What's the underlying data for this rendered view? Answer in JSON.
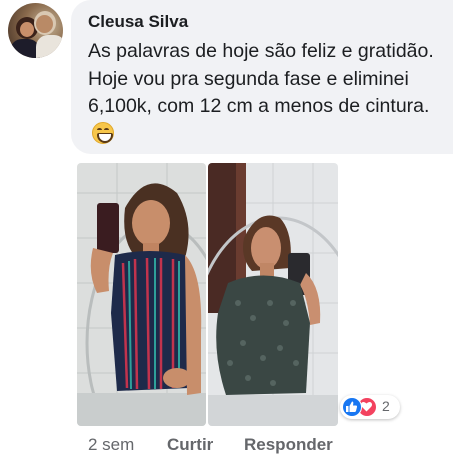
{
  "comment": {
    "author": "Cleusa Silva",
    "text": "As palavras de hoje são feliz e gratidão. Hoje vou pra segunda fase e eliminei 6,100k, com 12 cm a menos de cintura.",
    "emoji": "grinning-face-with-smiling-eyes"
  },
  "reactions": {
    "types": [
      "like",
      "love"
    ],
    "count": "2"
  },
  "actions": {
    "time": "2 sem",
    "like_label": "Curtir",
    "reply_label": "Responder"
  },
  "colors": {
    "bubble": "#f1f2f5",
    "text": "#1c1e21",
    "meta": "#65676b",
    "like": "#1877f2",
    "love": "#f3425f"
  }
}
